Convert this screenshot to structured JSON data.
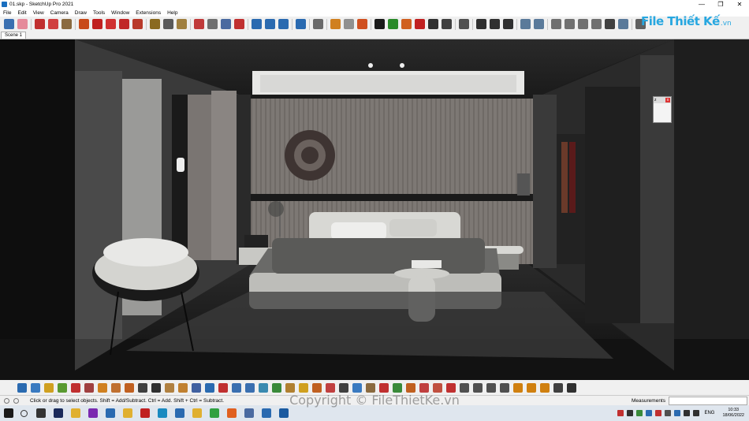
{
  "window": {
    "title": "01.skp - SketchUp Pro 2021",
    "minimize": "—",
    "maximize": "❐",
    "close": "✕"
  },
  "menu": [
    "File",
    "Edit",
    "View",
    "Camera",
    "Draw",
    "Tools",
    "Window",
    "Extensions",
    "Help"
  ],
  "brand": {
    "name": "File Thiết Kế",
    "suffix": ".vn"
  },
  "scenes": [
    {
      "label": "Scene 1"
    }
  ],
  "toolbar_top": [
    {
      "icon": "select-arrow-icon",
      "color": "#3a6fb0"
    },
    {
      "icon": "eraser-icon",
      "color": "#e58a9a"
    },
    {
      "sep": true
    },
    {
      "icon": "line-pencil-icon",
      "color": "#c03030"
    },
    {
      "icon": "arc-icon",
      "color": "#d04040"
    },
    {
      "icon": "rectangle-icon",
      "color": "#8a6a40"
    },
    {
      "sep": true
    },
    {
      "icon": "push-pull-icon",
      "color": "#c84a1a"
    },
    {
      "icon": "offset-icon",
      "color": "#c02020"
    },
    {
      "icon": "move-icon",
      "color": "#d03030"
    },
    {
      "icon": "rotate-icon",
      "color": "#c02828"
    },
    {
      "icon": "scale-icon",
      "color": "#b83a2a"
    },
    {
      "sep": true
    },
    {
      "icon": "tape-measure-icon",
      "color": "#8a6a20"
    },
    {
      "icon": "text-icon",
      "color": "#5a5a5a"
    },
    {
      "icon": "paint-bucket-icon",
      "color": "#a08040"
    },
    {
      "sep": true
    },
    {
      "icon": "orbit-icon",
      "color": "#c03a3a"
    },
    {
      "icon": "pan-icon",
      "color": "#707070"
    },
    {
      "icon": "zoom-icon",
      "color": "#4a6aa0"
    },
    {
      "icon": "zoom-extents-icon",
      "color": "#c03030"
    },
    {
      "sep": true
    },
    {
      "icon": "warehouse-icon",
      "color": "#2a6ab0"
    },
    {
      "icon": "extension-warehouse-icon",
      "color": "#2a6ab0"
    },
    {
      "icon": "layout-icon",
      "color": "#2a6ab0"
    },
    {
      "sep": true
    },
    {
      "icon": "style-builder-icon",
      "color": "#2a6ab0"
    },
    {
      "sep": true
    },
    {
      "icon": "components-icon",
      "color": "#6a6a6a"
    },
    {
      "sep": true
    },
    {
      "icon": "sandbox-icon",
      "color": "#d08020"
    },
    {
      "icon": "sync-icon",
      "color": "#909090"
    },
    {
      "icon": "report-icon",
      "color": "#d05020"
    },
    {
      "sep": true
    },
    {
      "icon": "add-location-icon",
      "color": "#1a1a1a"
    },
    {
      "icon": "terrain-icon",
      "color": "#2a8a2a"
    },
    {
      "icon": "photo-texture-icon",
      "color": "#d06020"
    },
    {
      "icon": "cloud-icon",
      "color": "#c02020"
    },
    {
      "icon": "checker-icon",
      "color": "#303030"
    },
    {
      "icon": "house-icon",
      "color": "#404040"
    },
    {
      "sep": true
    },
    {
      "icon": "gear-icon",
      "color": "#505050"
    },
    {
      "sep": true
    },
    {
      "icon": "mail-icon",
      "color": "#303030"
    },
    {
      "icon": "info-icon",
      "color": "#303030"
    },
    {
      "icon": "cart-icon",
      "color": "#303030"
    },
    {
      "sep": true
    },
    {
      "icon": "iso-view-icon",
      "color": "#5a7a9a"
    },
    {
      "icon": "top-view-icon",
      "color": "#5a7a9a"
    },
    {
      "sep": true
    },
    {
      "icon": "xray-icon",
      "color": "#707070"
    },
    {
      "icon": "back-edges-icon",
      "color": "#707070"
    },
    {
      "icon": "wireframe-icon",
      "color": "#707070"
    },
    {
      "icon": "hidden-line-icon",
      "color": "#707070"
    },
    {
      "icon": "shaded-icon",
      "color": "#404040"
    },
    {
      "icon": "shaded-texture-icon",
      "color": "#5a7a9a"
    },
    {
      "sep": true
    },
    {
      "icon": "section-plane-icon",
      "color": "#606060"
    }
  ],
  "toolbar_bottom": [
    {
      "icon": "face-blue-icon",
      "color": "#2a6ab0"
    },
    {
      "icon": "face-blue-icon",
      "color": "#3a7ac0"
    },
    {
      "icon": "face-yellow-icon",
      "color": "#d0a020"
    },
    {
      "icon": "face-green-icon",
      "color": "#5a9a30"
    },
    {
      "icon": "face-red-icon",
      "color": "#c03030"
    },
    {
      "icon": "box-icon",
      "color": "#a04040"
    },
    {
      "icon": "curve-icon",
      "color": "#d08020"
    },
    {
      "icon": "stretch-icon",
      "color": "#c07030"
    },
    {
      "icon": "grid-icon",
      "color": "#c06020"
    },
    {
      "icon": "table-icon",
      "color": "#404040"
    },
    {
      "icon": "frame-icon",
      "color": "#303030"
    },
    {
      "icon": "twist-icon",
      "color": "#b08040"
    },
    {
      "icon": "bend-icon",
      "color": "#c08030"
    },
    {
      "icon": "path-icon",
      "color": "#4060a0"
    },
    {
      "icon": "dots-icon",
      "color": "#2a6ab0"
    },
    {
      "icon": "cross-icon",
      "color": "#c03030"
    },
    {
      "icon": "asterisk-icon",
      "color": "#3a6fb0"
    },
    {
      "icon": "array-icon",
      "color": "#3a6fb0"
    },
    {
      "icon": "triangle-icon",
      "color": "#3a8ab0"
    },
    {
      "icon": "cone-icon",
      "color": "#3a8a3a"
    },
    {
      "icon": "warning-icon",
      "color": "#b08030"
    },
    {
      "icon": "bubble-icon",
      "color": "#d0a020"
    },
    {
      "icon": "ring-icon",
      "color": "#c06020"
    },
    {
      "icon": "flower-icon",
      "color": "#c04040"
    },
    {
      "icon": "swirl-icon",
      "color": "#404040"
    },
    {
      "icon": "snowflake-icon",
      "color": "#3a7ac0"
    },
    {
      "icon": "cylinder-icon",
      "color": "#8a6a40"
    },
    {
      "icon": "undo-shape-icon",
      "color": "#c03030"
    },
    {
      "icon": "puzzle-icon",
      "color": "#3a8a3a"
    },
    {
      "icon": "lock-icon",
      "color": "#c06020"
    },
    {
      "icon": "connect-icon",
      "color": "#c04040"
    },
    {
      "icon": "rotate-shape-icon",
      "color": "#c05040"
    },
    {
      "icon": "deform-icon",
      "color": "#c03030"
    },
    {
      "icon": "grid-small-icon",
      "color": "#505050"
    },
    {
      "icon": "grid-small-icon",
      "color": "#505050"
    },
    {
      "icon": "grid-small-icon",
      "color": "#505050"
    },
    {
      "icon": "grid-small-icon",
      "color": "#505050"
    },
    {
      "icon": "square-orange-icon",
      "color": "#d08010"
    },
    {
      "icon": "square-orange-icon",
      "color": "#d08010"
    },
    {
      "icon": "square-orange-icon",
      "color": "#d08010"
    },
    {
      "icon": "circle-icon",
      "color": "#404040"
    },
    {
      "icon": "selection-icon",
      "color": "#303030"
    }
  ],
  "status": {
    "hint": "Click or drag to select objects. Shift = Add/Subtract. Ctrl = Add. Shift + Ctrl = Subtract.",
    "measurements_label": "Measurements"
  },
  "taskbar": {
    "apps": [
      {
        "icon": "windows-start-icon",
        "color": "#1a1a1a"
      },
      {
        "icon": "task-view-icon",
        "color": "#333333"
      },
      {
        "icon": "photoshop-icon",
        "color": "#1a2a5a"
      },
      {
        "icon": "folder-icon",
        "color": "#e0b030"
      },
      {
        "icon": "app-purple-icon",
        "color": "#7a2ab0"
      },
      {
        "icon": "sketchup-icon",
        "color": "#2a6ab0"
      },
      {
        "icon": "folder-icon",
        "color": "#e0b030"
      },
      {
        "icon": "app-red-icon",
        "color": "#c02020"
      },
      {
        "icon": "edge-icon",
        "color": "#1a8ac0"
      },
      {
        "icon": "sketchup-icon",
        "color": "#2a6ab0"
      },
      {
        "icon": "file-explorer-icon",
        "color": "#e0b030"
      },
      {
        "icon": "chrome-icon",
        "color": "#30a040"
      },
      {
        "icon": "app-orange-icon",
        "color": "#e06020"
      },
      {
        "icon": "layout-icon",
        "color": "#4a6aa0"
      },
      {
        "icon": "sketchup-icon",
        "color": "#2a6ab0"
      },
      {
        "icon": "sketchup-icon",
        "color": "#1a5aa0"
      }
    ],
    "tray": [
      {
        "icon": "tray-red-icon",
        "color": "#c03030"
      },
      {
        "icon": "tray-chevron-icon",
        "color": "#303030"
      },
      {
        "icon": "tray-app-icon",
        "color": "#3a8a3a"
      },
      {
        "icon": "tray-app-icon",
        "color": "#2a6ab0"
      },
      {
        "icon": "tray-app-icon",
        "color": "#c03030"
      },
      {
        "icon": "tray-app-icon",
        "color": "#505050"
      },
      {
        "icon": "tray-app-icon",
        "color": "#2a6ab0"
      },
      {
        "icon": "network-icon",
        "color": "#303030"
      },
      {
        "icon": "volume-icon",
        "color": "#303030"
      }
    ],
    "lang": "ENG",
    "time": "10:33",
    "date": "18/06/2022"
  },
  "watermark": "Copyright © FileThietKe.vn"
}
